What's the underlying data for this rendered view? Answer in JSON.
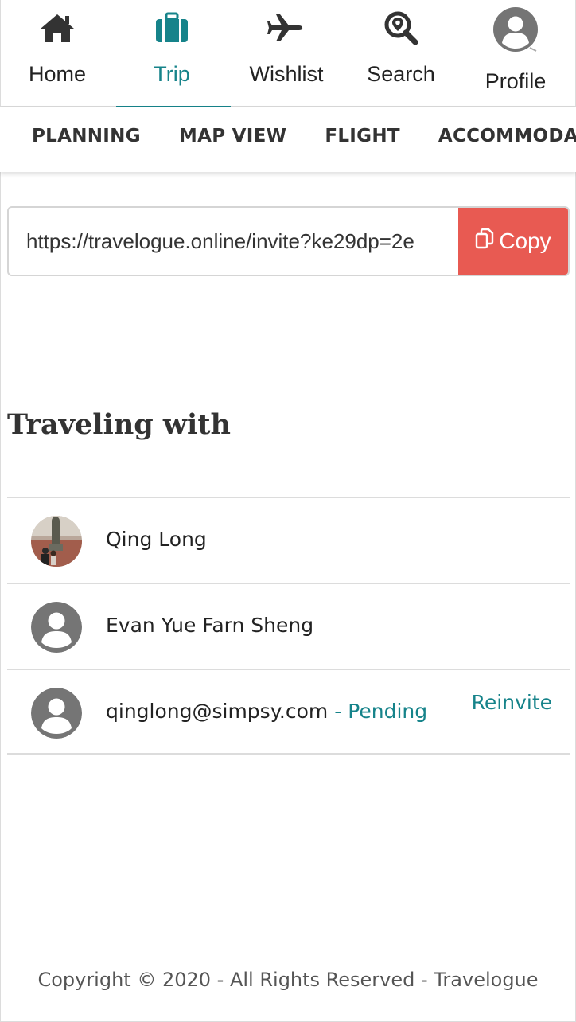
{
  "nav": {
    "items": [
      {
        "label": "Home",
        "icon": "home-icon"
      },
      {
        "label": "Trip",
        "icon": "suitcase-icon",
        "active": true
      },
      {
        "label": "Wishlist",
        "icon": "airplane-icon"
      },
      {
        "label": "Search",
        "icon": "search-location-icon"
      },
      {
        "label": "Profile",
        "icon": "user-avatar-icon"
      }
    ]
  },
  "subnav": {
    "items": [
      "PLANNING",
      "MAP VIEW",
      "FLIGHT",
      "ACCOMMODATION"
    ]
  },
  "invite": {
    "link": "https://travelogue.online/invite?ke29dp=2e",
    "copy_label": "Copy"
  },
  "traveling": {
    "title": "Traveling with",
    "members": [
      {
        "name": "Qing Long",
        "avatar": "photo"
      },
      {
        "name": "Evan Yue Farn Sheng",
        "avatar": "default"
      },
      {
        "name": "qinglong@simpsy.com",
        "status": " - Pending",
        "action": "Reinvite",
        "avatar": "default"
      }
    ]
  },
  "footer": {
    "text": "Copyright © 2020 - All Rights Reserved - Travelogue"
  },
  "colors": {
    "accent": "#16838a",
    "copy_button": "#e85a52",
    "icon_dark": "#333333",
    "avatar_gray": "#757575"
  }
}
